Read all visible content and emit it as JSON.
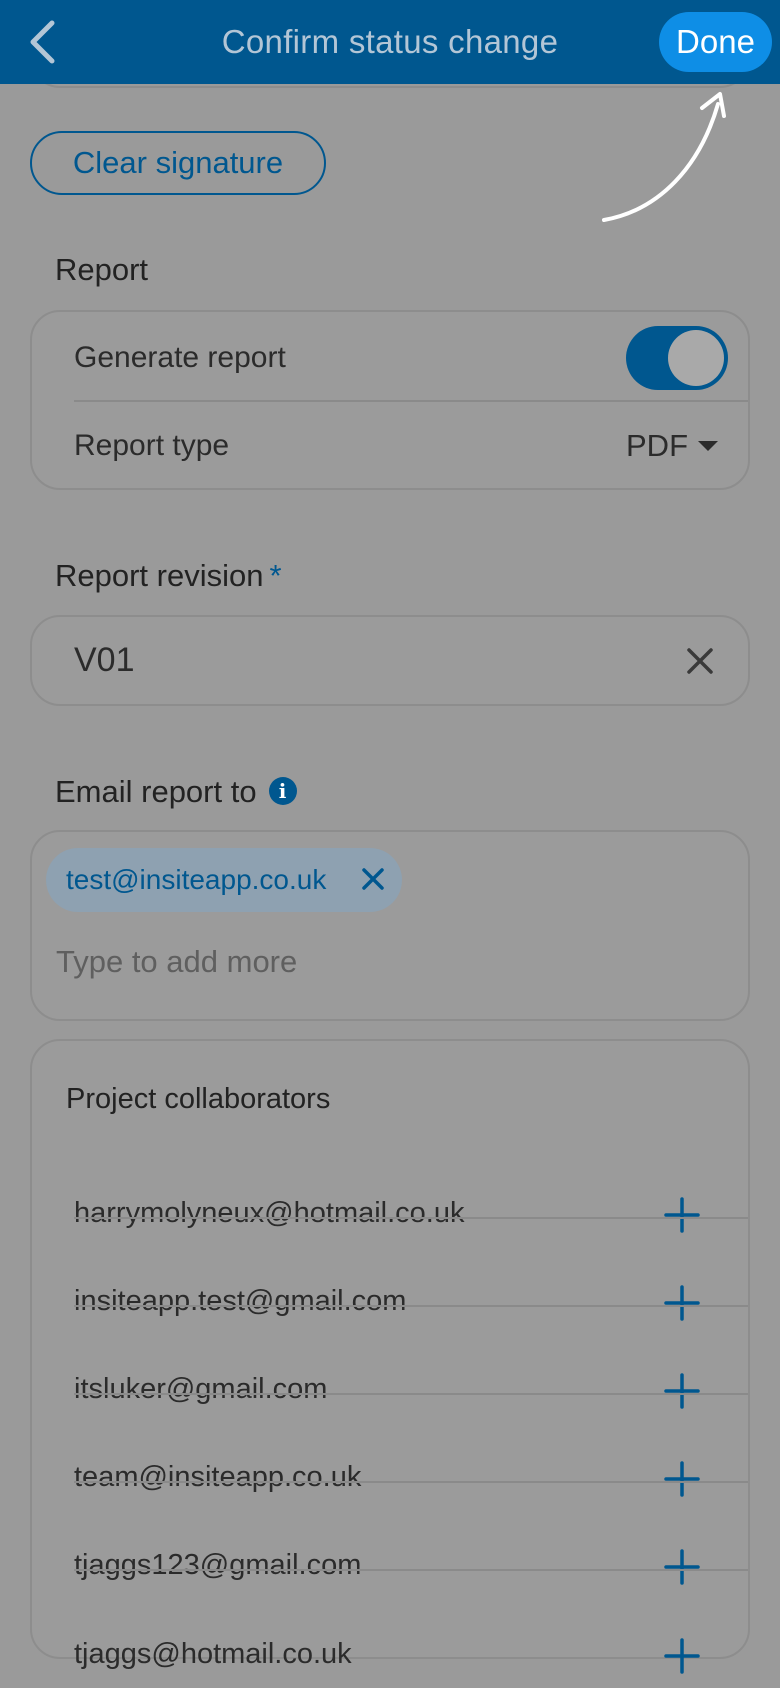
{
  "header": {
    "title": "Confirm status change",
    "done_label": "Done"
  },
  "signature": {
    "clear_label": "Clear signature"
  },
  "report": {
    "section_label": "Report",
    "generate_label": "Generate report",
    "generate_enabled": true,
    "type_label": "Report type",
    "type_value": "PDF"
  },
  "revision": {
    "label": "Report revision",
    "required_mark": "*",
    "value": "V01"
  },
  "email": {
    "label": "Email report to",
    "info_glyph": "i",
    "recipients": [
      "test@insiteapp.co.uk"
    ],
    "placeholder": "Type to add more"
  },
  "collaborators": {
    "title": "Project collaborators",
    "items": [
      "harrymolyneux@hotmail.co.uk",
      "insiteapp.test@gmail.com",
      "itsluker@gmail.com",
      "team@insiteapp.co.uk",
      "tjaggs123@gmail.com",
      "tjaggs@hotmail.co.uk"
    ]
  },
  "colors": {
    "brand": "#00578f",
    "accent": "#0e8ee6",
    "overlay_bg": "#9a9a9a"
  },
  "icons": {
    "back": "chevron-left-icon",
    "annotation": "curved-arrow-icon",
    "clear": "close-icon",
    "add": "plus-icon",
    "info": "info-icon",
    "dropdown": "caret-down-icon"
  }
}
